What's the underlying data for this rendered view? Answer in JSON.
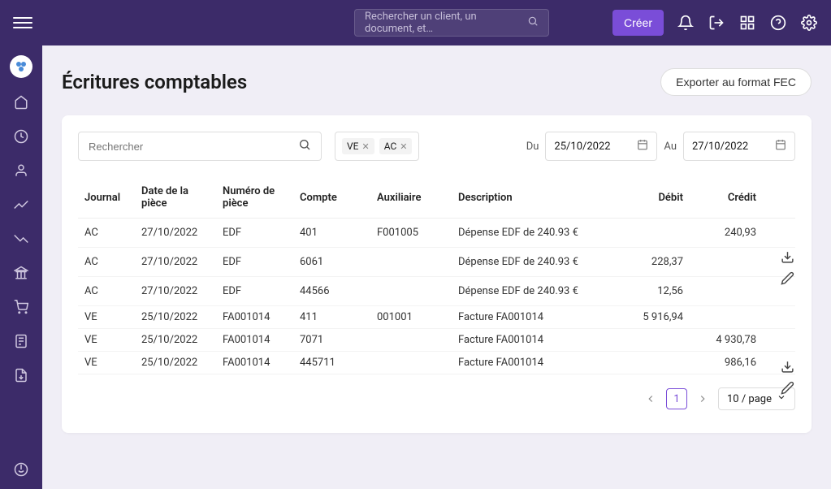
{
  "header": {
    "search_placeholder": "Rechercher un client, un document, et…",
    "create_label": "Créer"
  },
  "page": {
    "title": "Écritures comptables",
    "export_label": "Exporter au format FEC"
  },
  "filters": {
    "search_placeholder": "Rechercher",
    "chips": [
      {
        "label": "VE"
      },
      {
        "label": "AC"
      }
    ],
    "date_from_label": "Du",
    "date_from": "25/10/2022",
    "date_to_label": "Au",
    "date_to": "27/10/2022"
  },
  "table": {
    "columns": {
      "journal": "Journal",
      "date": "Date de la pièce",
      "numero": "Numéro de pièce",
      "compte": "Compte",
      "auxiliaire": "Auxiliaire",
      "description": "Description",
      "debit": "Débit",
      "credit": "Crédit"
    },
    "rows": [
      {
        "journal": "AC",
        "date": "27/10/2022",
        "numero": "EDF",
        "compte": "401",
        "auxiliaire": "F001005",
        "description": "Dépense EDF de 240.93 €",
        "debit": "",
        "credit": "240,93"
      },
      {
        "journal": "AC",
        "date": "27/10/2022",
        "numero": "EDF",
        "compte": "6061",
        "auxiliaire": "",
        "description": "Dépense EDF de 240.93 €",
        "debit": "228,37",
        "credit": ""
      },
      {
        "journal": "AC",
        "date": "27/10/2022",
        "numero": "EDF",
        "compte": "44566",
        "auxiliaire": "",
        "description": "Dépense EDF de 240.93 €",
        "debit": "12,56",
        "credit": ""
      },
      {
        "journal": "VE",
        "date": "25/10/2022",
        "numero": "FA001014",
        "compte": "411",
        "auxiliaire": "001001",
        "description": "Facture FA001014",
        "debit": "5 916,94",
        "credit": ""
      },
      {
        "journal": "VE",
        "date": "25/10/2022",
        "numero": "FA001014",
        "compte": "7071",
        "auxiliaire": "",
        "description": "Facture FA001014",
        "debit": "",
        "credit": "4 930,78"
      },
      {
        "journal": "VE",
        "date": "25/10/2022",
        "numero": "FA001014",
        "compte": "445711",
        "auxiliaire": "",
        "description": "Facture FA001014",
        "debit": "",
        "credit": "986,16"
      }
    ]
  },
  "pagination": {
    "current": "1",
    "size_label": "10 / page"
  }
}
